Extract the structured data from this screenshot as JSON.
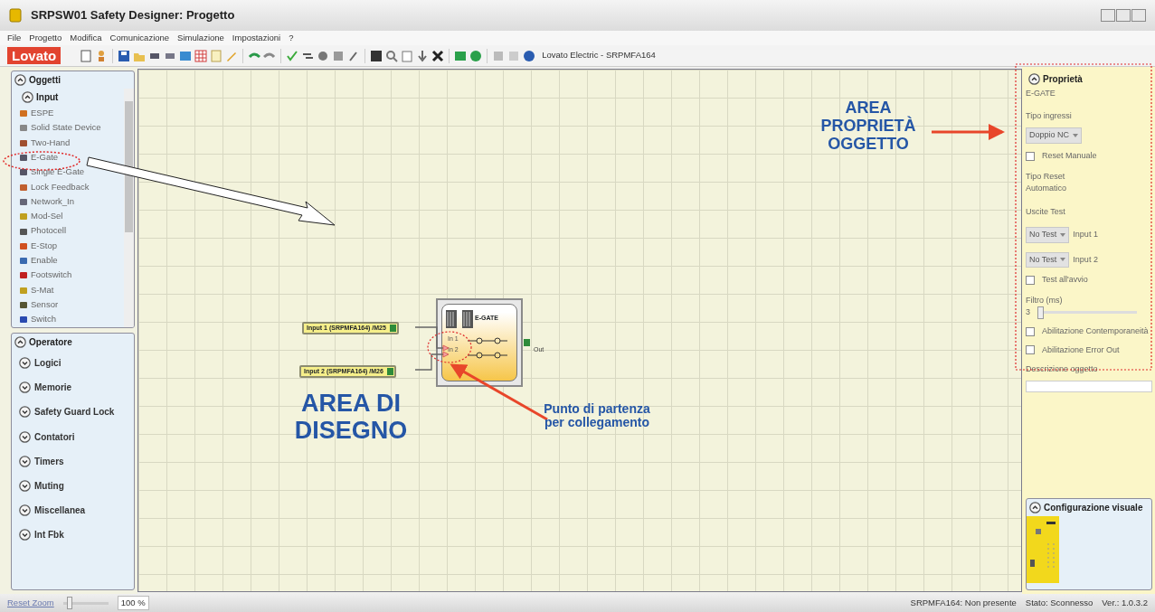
{
  "window": {
    "title": "SRPSW01 Safety Designer: Progetto"
  },
  "menu": [
    "File",
    "Progetto",
    "Modifica",
    "Comunicazione",
    "Simulazione",
    "Impostazioni",
    "?"
  ],
  "toolbar": {
    "logo": "Lovato",
    "device": "Lovato Electric - SRPMFA164"
  },
  "objects_panel": {
    "title": "Oggetti",
    "expanded": true,
    "groups": [
      {
        "title": "Input",
        "expanded": true,
        "items": [
          "ESPE",
          "Solid State Device",
          "Two-Hand",
          "E-Gate",
          "Single E-Gate",
          "Lock Feedback",
          "Network_In",
          "Mod-Sel",
          "Photocell",
          "E-Stop",
          "Enable",
          "Footswitch",
          "S-Mat",
          "Sensor",
          "Switch"
        ]
      }
    ]
  },
  "operator_panel": {
    "title": "Operatore",
    "expanded": true,
    "groups": [
      {
        "title": "Logici",
        "expanded": false
      },
      {
        "title": "Memorie",
        "expanded": false
      },
      {
        "title": "Safety Guard Lock",
        "expanded": false
      },
      {
        "title": "Contatori",
        "expanded": false
      },
      {
        "title": "Timers",
        "expanded": false
      },
      {
        "title": "Muting",
        "expanded": false
      },
      {
        "title": "Miscellanea",
        "expanded": false
      },
      {
        "title": "Int Fbk",
        "expanded": false
      }
    ]
  },
  "canvas": {
    "nodes": [
      {
        "kind": "input",
        "label": "Input 1 (SRPMFA164) /M25"
      },
      {
        "kind": "input",
        "label": "Input 2 (SRPMFA164) /M26"
      },
      {
        "kind": "block",
        "title": "E-GATE",
        "inputs": [
          "In 1",
          "In 2"
        ],
        "output": "Out"
      }
    ]
  },
  "annotations": [
    {
      "kind": "title",
      "text": "AREA DI DISEGNO"
    },
    {
      "kind": "note",
      "text": "Punto di partenza per collegamento"
    },
    {
      "kind": "label",
      "text": "AREA PROPRIETÀ OGGETTO"
    }
  ],
  "properties": {
    "title": "Proprietà",
    "expanded": true,
    "object": "E-GATE",
    "fields": [
      {
        "kind": "select",
        "label": "Tipo ingressi",
        "value": "Doppio NC"
      },
      {
        "kind": "checkbox",
        "label": "Reset Manuale",
        "checked": false
      },
      {
        "kind": "text",
        "label": "Tipo Reset",
        "value": "Automatico"
      },
      {
        "kind": "heading",
        "label": "Uscite Test"
      },
      {
        "kind": "inline_select",
        "value": "No Test",
        "label": "Input 1"
      },
      {
        "kind": "inline_select",
        "value": "No Test",
        "label": "Input 2"
      },
      {
        "kind": "checkbox",
        "label": "Test all'avvio",
        "checked": false
      },
      {
        "kind": "slider",
        "label": "Filtro (ms)",
        "value": "3",
        "level": 0
      },
      {
        "kind": "checkbox",
        "label": "Abilitazione Contemporaneità",
        "checked": false
      },
      {
        "kind": "checkbox",
        "label": "Abilitazione Error Out",
        "checked": false
      },
      {
        "kind": "textfield",
        "label": "Descrizione oggetto"
      }
    ]
  },
  "visual_config": {
    "title": "Configurazione visuale",
    "expanded": true
  },
  "zoom": {
    "reset": "Reset Zoom",
    "level": 0.1,
    "value": "100 %"
  },
  "status_bar": [
    "SRPMFA164: Non presente",
    "Stato: Sconnesso",
    "Ver.: 1.0.3.2"
  ]
}
